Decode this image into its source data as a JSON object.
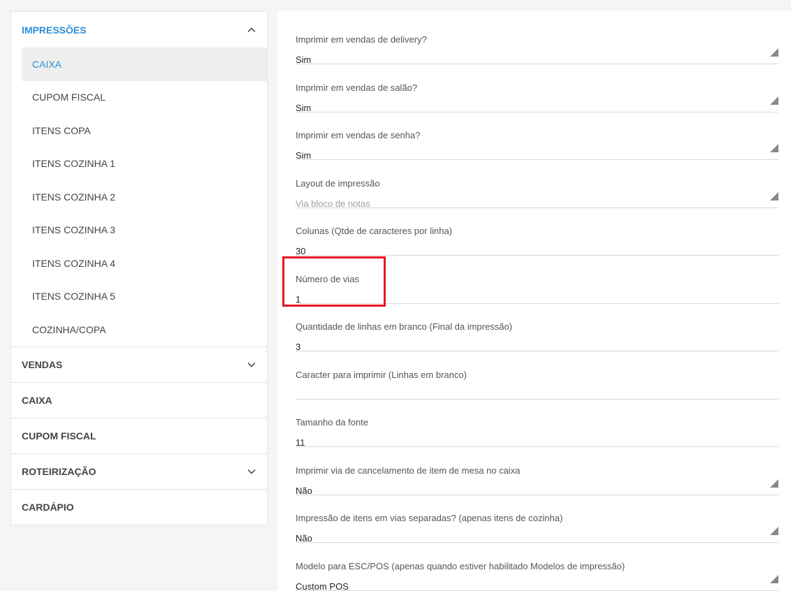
{
  "sidebar": {
    "sections": [
      {
        "label": "IMPRESSÕES"
      },
      {
        "label": "VENDAS"
      },
      {
        "label": "CAIXA"
      },
      {
        "label": "CUPOM FISCAL"
      },
      {
        "label": "ROTEIRIZAÇÃO"
      },
      {
        "label": "CARDÁPIO"
      }
    ],
    "impressoes_items": [
      {
        "label": "CAIXA"
      },
      {
        "label": "CUPOM FISCAL"
      },
      {
        "label": "ITENS COPA"
      },
      {
        "label": "ITENS COZINHA 1"
      },
      {
        "label": "ITENS COZINHA 2"
      },
      {
        "label": "ITENS COZINHA 3"
      },
      {
        "label": "ITENS COZINHA 4"
      },
      {
        "label": "ITENS COZINHA 5"
      },
      {
        "label": "COZINHA/COPA"
      }
    ]
  },
  "form": {
    "fields": [
      {
        "label": "Imprimir em vendas de delivery?",
        "value": "Sim"
      },
      {
        "label": "Imprimir em vendas de salão?",
        "value": "Sim"
      },
      {
        "label": "Imprimir em vendas de senha?",
        "value": "Sim"
      },
      {
        "label": "Layout de impressão",
        "value": "Via bloco de notas"
      },
      {
        "label": "Colunas (Qtde de caracteres por linha)",
        "value": "30"
      },
      {
        "label": "Número de vias",
        "value": "1"
      },
      {
        "label": "Quantidade de linhas em branco (Final da impressão)",
        "value": "3"
      },
      {
        "label": "Caracter para imprimir (Linhas em branco)",
        "value": ""
      },
      {
        "label": "Tamanho da fonte",
        "value": "11"
      },
      {
        "label": "Imprimir via de cancelamento de item de mesa no caixa",
        "value": "Não"
      },
      {
        "label": "Impressão de itens em vias separadas? (apenas itens de cozinha)",
        "value": "Não"
      },
      {
        "label": "Modelo para ESC/POS (apenas quando estiver habilitado Modelos de impressão)",
        "value": "Custom POS"
      }
    ]
  },
  "colors": {
    "accent": "#2e8fd6",
    "highlight": "#e8161f"
  }
}
